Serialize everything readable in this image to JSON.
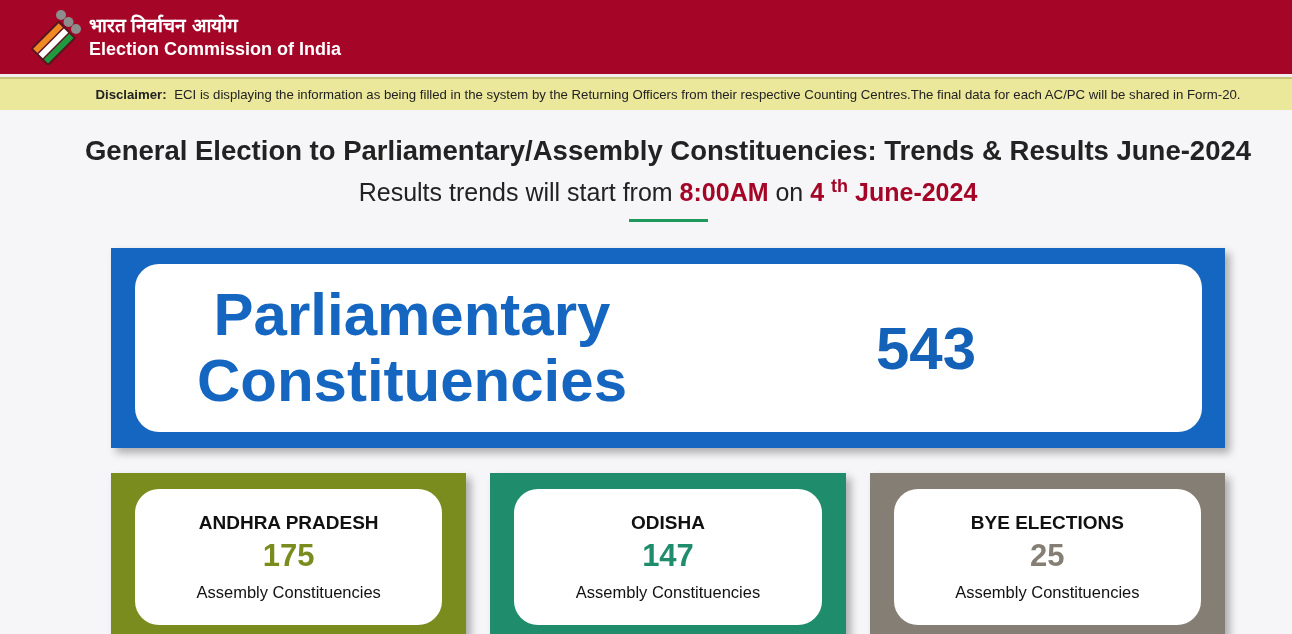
{
  "header": {
    "org_name_hindi": "भारत निर्वाचन आयोग",
    "org_name": "Election Commission of India"
  },
  "disclaimer": "**Disclaimer:**  ECI is displaying the information as being filled in the system by the Returning Officers from their respective Counting Centres.The final data for each AC/PC will be shared in Form-20.",
  "title": "General Election to Parliamentary/Assembly Constituencies: Trends & Results June-2024",
  "subtitle": "Results trends will start from **8:00AM** on **4** $^{th}$ **June-2024**",
  "parliamentary": {
    "label": "Parliamentary Constituencies",
    "count": "543"
  },
  "states": [
    {
      "name": "ANDHRA PRADESH",
      "count": "175",
      "label": "Assembly Constituencies",
      "color": "#7b8c1f"
    },
    {
      "name": "ODISHA",
      "count": "147",
      "label": "Assembly Constituencies",
      "color": "#1f8c6c"
    },
    {
      "name": "BYE ELECTIONS",
      "count": "25",
      "label": "Assembly Constituencies",
      "color": "#857e74"
    }
  ]
}
